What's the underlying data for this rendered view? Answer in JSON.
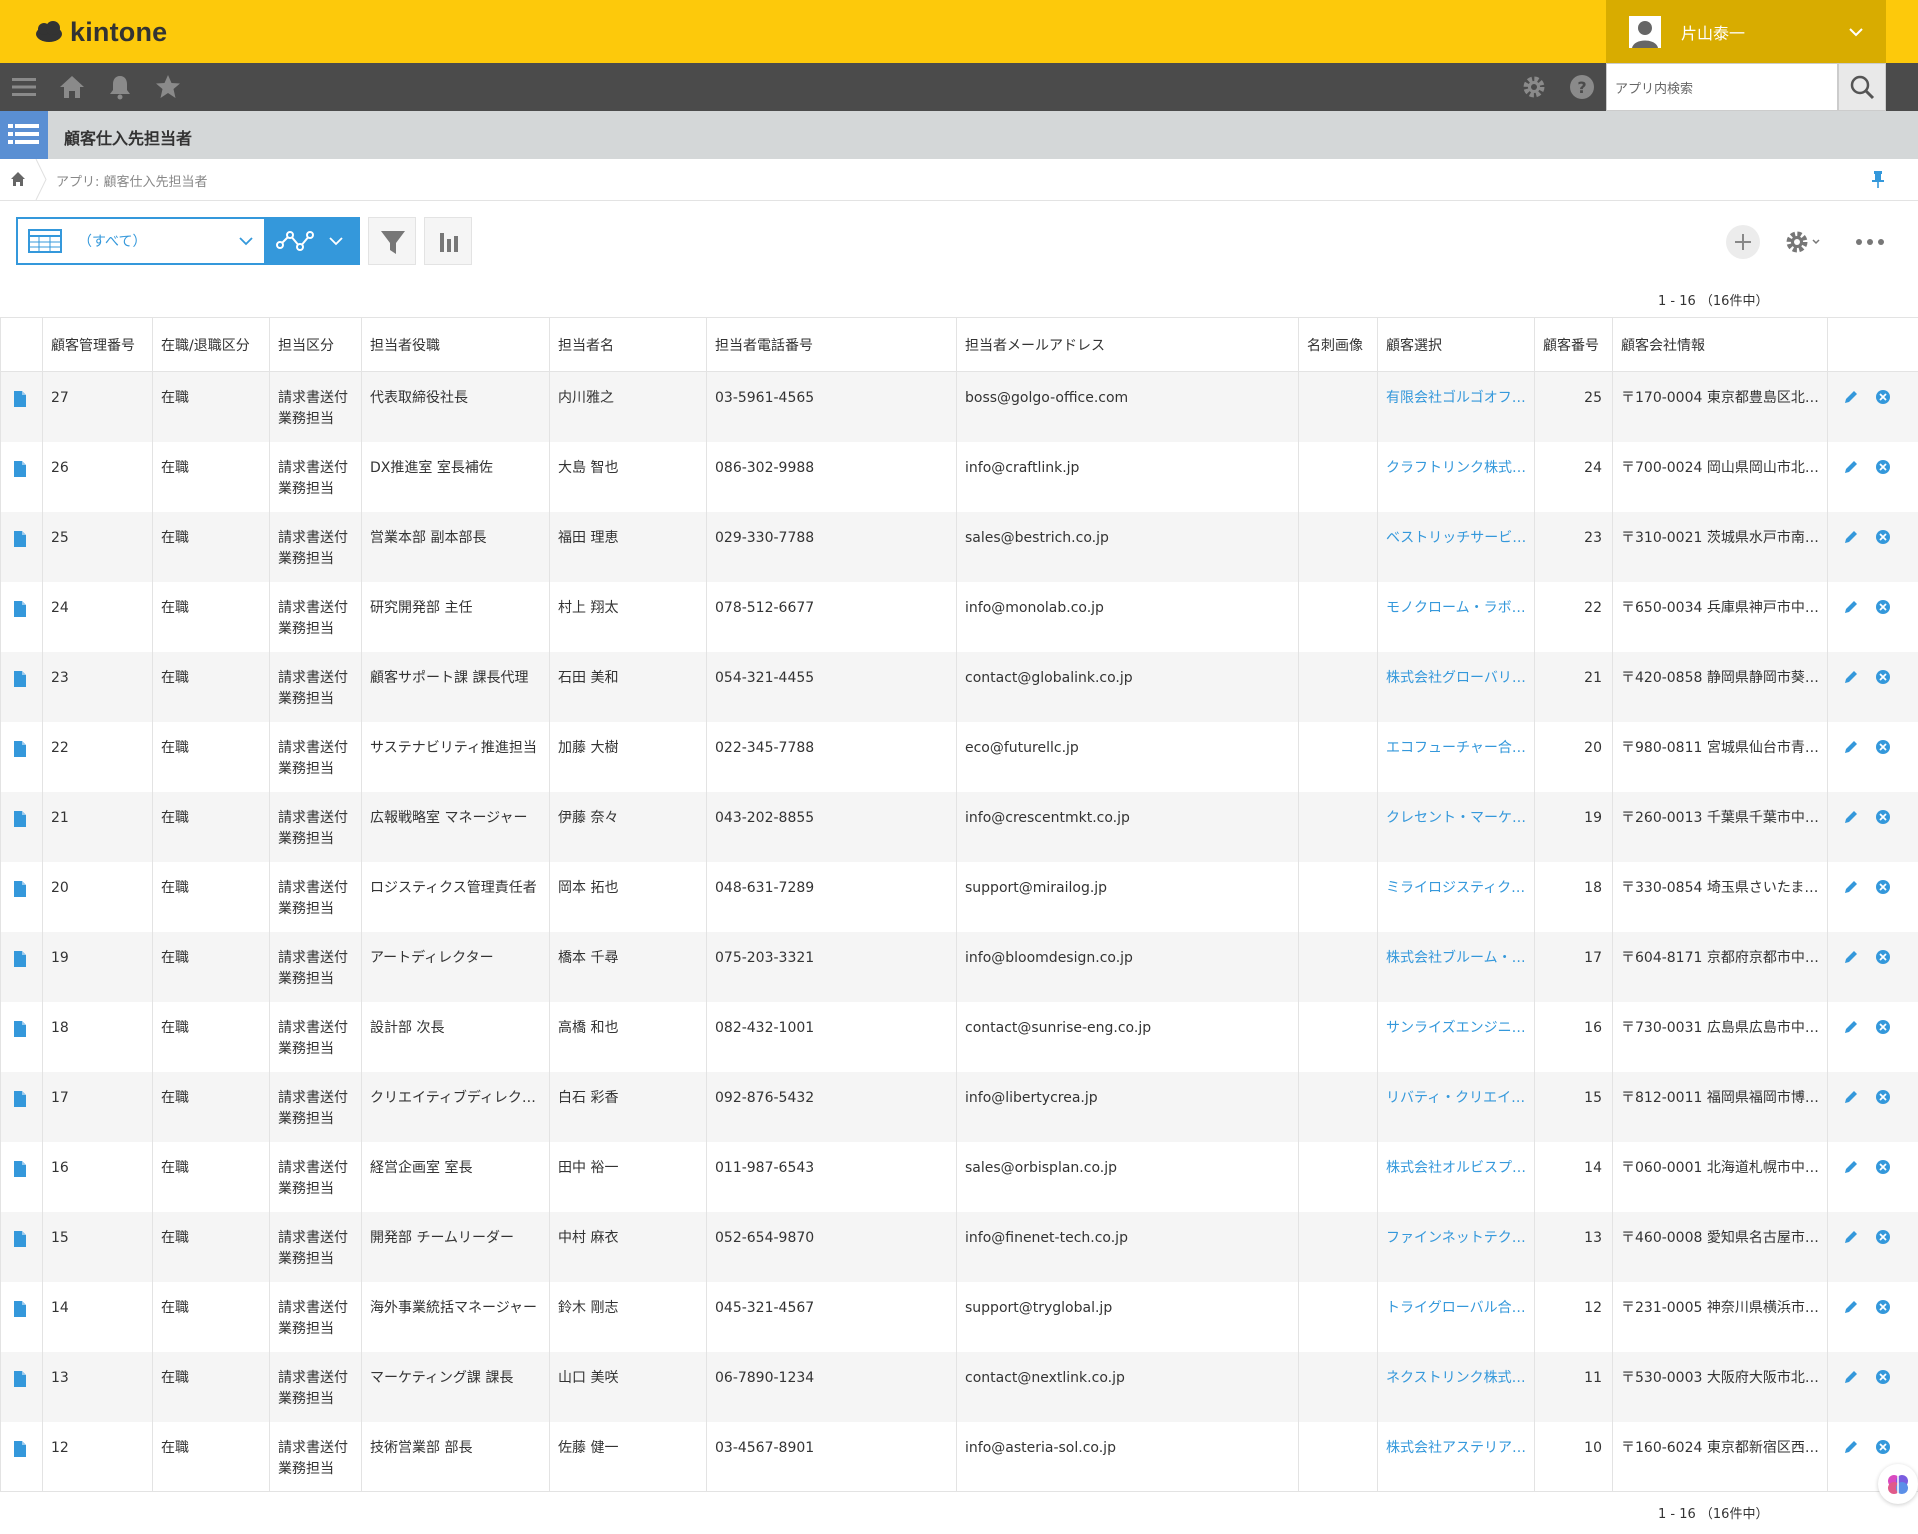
{
  "brand": {
    "name": "kintone",
    "color": "#fdc90b"
  },
  "user": {
    "name": "片山泰一"
  },
  "nav": {
    "search_placeholder": "アプリ内検索"
  },
  "app": {
    "title": "顧客仕入先担当者"
  },
  "breadcrumb": {
    "text": "アプリ: 顧客仕入先担当者"
  },
  "toolbar": {
    "view_label": "（すべて）"
  },
  "pager": {
    "top": "1 - 16 （16件中）",
    "bottom": "1 - 16 （16件中）"
  },
  "columns": [
    "顧客管理番号",
    "在職/退職区分",
    "担当区分",
    "担当者役職",
    "担当者名",
    "担当者電話番号",
    "担当者メールアドレス",
    "名刺画像",
    "顧客選択",
    "顧客番号",
    "顧客会社情報"
  ],
  "rows": [
    {
      "id": "27",
      "status": "在職",
      "cat1": "請求書送付",
      "cat2": "業務担当",
      "title": "代表取締役社長",
      "name": "内川雅之",
      "phone": "03-5961-4565",
      "email": "boss@golgo-office.com",
      "customer": "有限会社ゴルゴオフ…",
      "cust_no": "25",
      "info": "〒170-0004 東京都豊島区北…"
    },
    {
      "id": "26",
      "status": "在職",
      "cat1": "請求書送付",
      "cat2": "業務担当",
      "title": "DX推進室 室長補佐",
      "name": "大島 智也",
      "phone": "086-302-9988",
      "email": "info@craftlink.jp",
      "customer": "クラフトリンク株式…",
      "cust_no": "24",
      "info": "〒700-0024 岡山県岡山市北…"
    },
    {
      "id": "25",
      "status": "在職",
      "cat1": "請求書送付",
      "cat2": "業務担当",
      "title": "営業本部 副本部長",
      "name": "福田 理恵",
      "phone": "029-330-7788",
      "email": "sales@bestrich.co.jp",
      "customer": "ベストリッチサービ…",
      "cust_no": "23",
      "info": "〒310-0021 茨城県水戸市南…"
    },
    {
      "id": "24",
      "status": "在職",
      "cat1": "請求書送付",
      "cat2": "業務担当",
      "title": "研究開発部 主任",
      "name": "村上 翔太",
      "phone": "078-512-6677",
      "email": "info@monolab.co.jp",
      "customer": "モノクローム・ラボ…",
      "cust_no": "22",
      "info": "〒650-0034 兵庫県神戸市中…"
    },
    {
      "id": "23",
      "status": "在職",
      "cat1": "請求書送付",
      "cat2": "業務担当",
      "title": "顧客サポート課 課長代理",
      "name": "石田 美和",
      "phone": "054-321-4455",
      "email": "contact@globalink.co.jp",
      "customer": "株式会社グローバリ…",
      "cust_no": "21",
      "info": "〒420-0858 静岡県静岡市葵…"
    },
    {
      "id": "22",
      "status": "在職",
      "cat1": "請求書送付",
      "cat2": "業務担当",
      "title": "サステナビリティ推進担当",
      "name": "加藤 大樹",
      "phone": "022-345-7788",
      "email": "eco@futurellc.jp",
      "customer": "エコフューチャー合…",
      "cust_no": "20",
      "info": "〒980-0811 宮城県仙台市青…"
    },
    {
      "id": "21",
      "status": "在職",
      "cat1": "請求書送付",
      "cat2": "業務担当",
      "title": "広報戦略室 マネージャー",
      "name": "伊藤 奈々",
      "phone": "043-202-8855",
      "email": "info@crescentmkt.co.jp",
      "customer": "クレセント・マーケ…",
      "cust_no": "19",
      "info": "〒260-0013 千葉県千葉市中…"
    },
    {
      "id": "20",
      "status": "在職",
      "cat1": "請求書送付",
      "cat2": "業務担当",
      "title": "ロジスティクス管理責任者",
      "name": "岡本 拓也",
      "phone": "048-631-7289",
      "email": "support@mirailog.jp",
      "customer": "ミライロジスティク…",
      "cust_no": "18",
      "info": "〒330-0854 埼玉県さいたま…"
    },
    {
      "id": "19",
      "status": "在職",
      "cat1": "請求書送付",
      "cat2": "業務担当",
      "title": "アートディレクター",
      "name": "橋本 千尋",
      "phone": "075-203-3321",
      "email": "info@bloomdesign.co.jp",
      "customer": "株式会社ブルーム・…",
      "cust_no": "17",
      "info": "〒604-8171 京都府京都市中…"
    },
    {
      "id": "18",
      "status": "在職",
      "cat1": "請求書送付",
      "cat2": "業務担当",
      "title": "設計部 次長",
      "name": "高橋 和也",
      "phone": "082-432-1001",
      "email": "contact@sunrise-eng.co.jp",
      "customer": "サンライズエンジニ…",
      "cust_no": "16",
      "info": "〒730-0031 広島県広島市中…"
    },
    {
      "id": "17",
      "status": "在職",
      "cat1": "請求書送付",
      "cat2": "業務担当",
      "title": "クリエイティブディレク…",
      "name": "白石 彩香",
      "phone": "092-876-5432",
      "email": "info@libertycrea.jp",
      "customer": "リバティ・クリエイ…",
      "cust_no": "15",
      "info": "〒812-0011 福岡県福岡市博…"
    },
    {
      "id": "16",
      "status": "在職",
      "cat1": "請求書送付",
      "cat2": "業務担当",
      "title": "経営企画室 室長",
      "name": "田中 裕一",
      "phone": "011-987-6543",
      "email": "sales@orbisplan.co.jp",
      "customer": "株式会社オルビスプ…",
      "cust_no": "14",
      "info": "〒060-0001 北海道札幌市中…"
    },
    {
      "id": "15",
      "status": "在職",
      "cat1": "請求書送付",
      "cat2": "業務担当",
      "title": "開発部 チームリーダー",
      "name": "中村 麻衣",
      "phone": "052-654-9870",
      "email": "info@finenet-tech.co.jp",
      "customer": "ファインネットテク…",
      "cust_no": "13",
      "info": "〒460-0008 愛知県名古屋市…"
    },
    {
      "id": "14",
      "status": "在職",
      "cat1": "請求書送付",
      "cat2": "業務担当",
      "title": "海外事業統括マネージャー",
      "name": "鈴木 剛志",
      "phone": "045-321-4567",
      "email": "support@tryglobal.jp",
      "customer": "トライグローバル合…",
      "cust_no": "12",
      "info": "〒231-0005 神奈川県横浜市…"
    },
    {
      "id": "13",
      "status": "在職",
      "cat1": "請求書送付",
      "cat2": "業務担当",
      "title": "マーケティング課 課長",
      "name": "山口 美咲",
      "phone": "06-7890-1234",
      "email": "contact@nextlink.co.jp",
      "customer": "ネクストリンク株式…",
      "cust_no": "11",
      "info": "〒530-0003 大阪府大阪市北…"
    },
    {
      "id": "12",
      "status": "在職",
      "cat1": "請求書送付",
      "cat2": "業務担当",
      "title": "技術営業部 部長",
      "name": "佐藤 健一",
      "phone": "03-4567-8901",
      "email": "info@asteria-sol.co.jp",
      "customer": "株式会社アステリア…",
      "cust_no": "10",
      "info": "〒160-6024 東京都新宿区西…"
    }
  ]
}
